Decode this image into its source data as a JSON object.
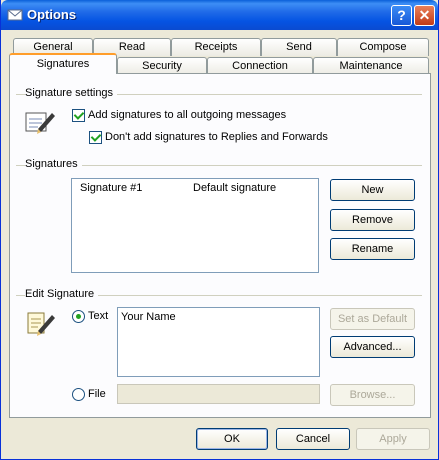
{
  "window": {
    "title": "Options"
  },
  "tabs_row1": [
    "General",
    "Read",
    "Receipts",
    "Send",
    "Compose"
  ],
  "tabs_row2": [
    "Signatures",
    "Security",
    "Connection",
    "Maintenance"
  ],
  "signature_settings": {
    "heading": "Signature settings",
    "add_all": "Add signatures to all outgoing messages",
    "no_replies": "Don't add signatures to Replies and Forwards"
  },
  "signatures": {
    "heading": "Signatures",
    "items": [
      {
        "name": "Signature #1",
        "note": "Default signature"
      }
    ],
    "new_label": "New",
    "remove_label": "Remove",
    "rename_label": "Rename"
  },
  "edit_signature": {
    "heading": "Edit Signature",
    "text_option": "Text",
    "text_value": "Your Name",
    "file_option": "File",
    "file_value": "",
    "set_default_label": "Set as Default",
    "advanced_label": "Advanced...",
    "browse_label": "Browse..."
  },
  "footer": {
    "ok": "OK",
    "cancel": "Cancel",
    "apply": "Apply"
  }
}
